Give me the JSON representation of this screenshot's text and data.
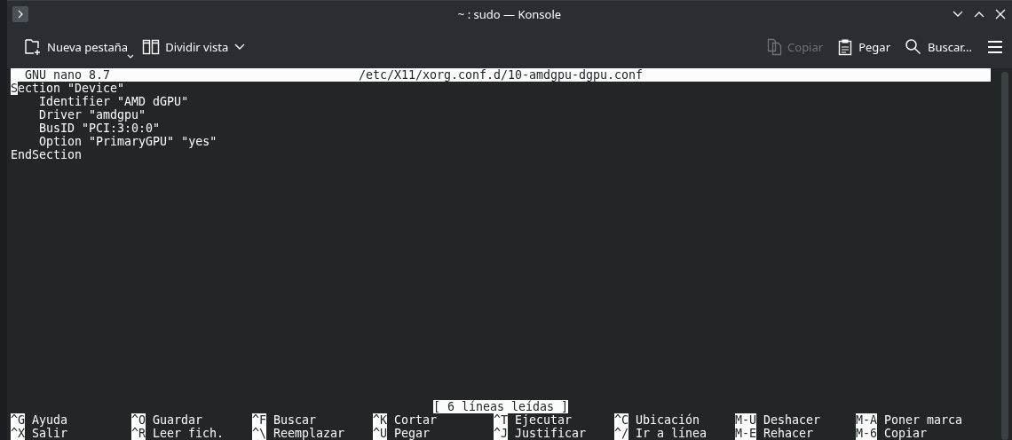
{
  "window": {
    "title": "~ : sudo — Konsole"
  },
  "toolbar": {
    "left": [
      {
        "kind": "new-tab",
        "label": "Nueva pestaña",
        "disabled": false
      },
      {
        "kind": "split",
        "label": "Dividir vista",
        "disabled": false
      }
    ],
    "right": [
      {
        "kind": "copy",
        "label": "Copiar",
        "disabled": true
      },
      {
        "kind": "paste",
        "label": "Pegar",
        "disabled": false
      },
      {
        "kind": "search",
        "label": "Buscar...",
        "disabled": false
      }
    ]
  },
  "nano": {
    "program": "GNU nano 8.7",
    "filename": "/etc/X11/xorg.conf.d/10-amdgpu-dgpu.conf",
    "lines": [
      {
        "text": "Section \"Device\"",
        "cursor": true
      },
      {
        "text": "    Identifier \"AMD dGPU\"",
        "cursor": false
      },
      {
        "text": "    Driver \"amdgpu\"",
        "cursor": false
      },
      {
        "text": "    BusID \"PCI:3:0:0\"",
        "cursor": false
      },
      {
        "text": "    Option \"PrimaryGPU\" \"yes\"",
        "cursor": false
      },
      {
        "text": "EndSection",
        "cursor": false
      }
    ],
    "status": "[ 6 líneas leídas ]",
    "shortcuts": [
      [
        {
          "key": "^G",
          "label": "Ayuda"
        },
        {
          "key": "^O",
          "label": "Guardar"
        },
        {
          "key": "^F",
          "label": "Buscar"
        },
        {
          "key": "^K",
          "label": "Cortar"
        },
        {
          "key": "^T",
          "label": "Ejecutar"
        },
        {
          "key": "^C",
          "label": "Ubicación"
        },
        {
          "key": "M-U",
          "label": "Deshacer"
        },
        {
          "key": "M-A",
          "label": "Poner marca"
        }
      ],
      [
        {
          "key": "^X",
          "label": "Salir"
        },
        {
          "key": "^R",
          "label": "Leer fich."
        },
        {
          "key": "^\\",
          "label": "Reemplazar"
        },
        {
          "key": "^U",
          "label": "Pegar"
        },
        {
          "key": "^J",
          "label": "Justificar"
        },
        {
          "key": "^/",
          "label": "Ir a línea"
        },
        {
          "key": "M-E",
          "label": "Rehacer"
        },
        {
          "key": "M-6",
          "label": "Copiar"
        }
      ]
    ]
  }
}
